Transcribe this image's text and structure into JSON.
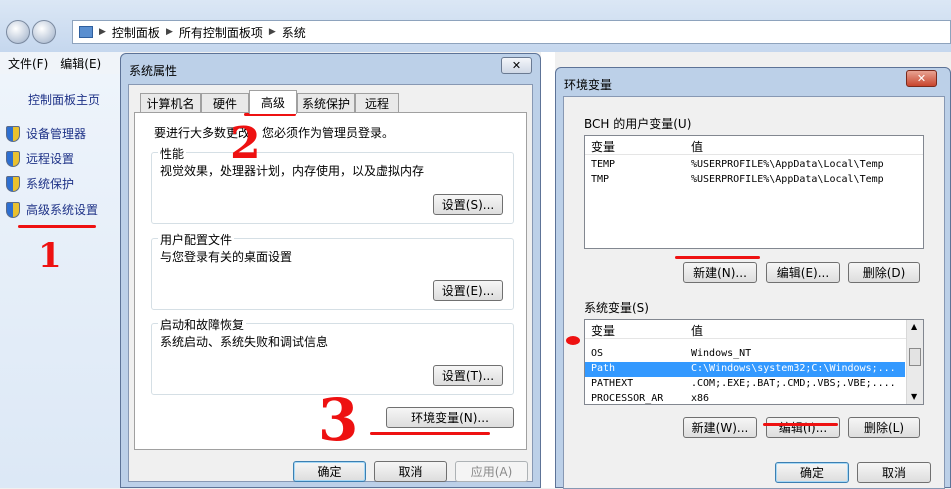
{
  "explorer": {
    "breadcrumb": [
      "控制面板",
      "所有控制面板项",
      "系统"
    ],
    "menu": [
      "文件(F)",
      "编辑(E)"
    ],
    "left_nav": {
      "home": "控制面板主页",
      "items": [
        "设备管理器",
        "远程设置",
        "系统保护",
        "高级系统设置"
      ]
    }
  },
  "system_properties": {
    "title": "系统属性",
    "tabs": [
      "计算机名",
      "硬件",
      "高级",
      "系统保护",
      "远程"
    ],
    "active_tab": "高级",
    "admin_note": "要进行大多数更改，您必须作为管理员登录。",
    "groups": [
      {
        "label": "性能",
        "text": "视觉效果，处理器计划，内存使用，以及虚拟内存",
        "button": "设置(S)..."
      },
      {
        "label": "用户配置文件",
        "text": "与您登录有关的桌面设置",
        "button": "设置(E)..."
      },
      {
        "label": "启动和故障恢复",
        "text": "系统启动、系统失败和调试信息",
        "button": "设置(T)..."
      }
    ],
    "env_button": "环境变量(N)...",
    "ok": "确定",
    "cancel": "取消",
    "apply": "应用(A)"
  },
  "environment_variables": {
    "title": "环境变量",
    "user_section": "BCH 的用户变量(U)",
    "columns": [
      "变量",
      "值"
    ],
    "user_vars": [
      {
        "name": "TEMP",
        "value": "%USERPROFILE%\\AppData\\Local\\Temp"
      },
      {
        "name": "TMP",
        "value": "%USERPROFILE%\\AppData\\Local\\Temp"
      }
    ],
    "user_buttons": [
      "新建(N)...",
      "编辑(E)...",
      "删除(D)"
    ],
    "system_section": "系统变量(S)",
    "system_vars": [
      {
        "name": "OS",
        "value": "Windows_NT"
      },
      {
        "name": "Path",
        "value": "C:\\Windows\\system32;C:\\Windows;..."
      },
      {
        "name": "PATHEXT",
        "value": ".COM;.EXE;.BAT;.CMD;.VBS;.VBE;...."
      },
      {
        "name": "PROCESSOR_AR",
        "value": "x86"
      }
    ],
    "selected_system_var": "Path",
    "system_buttons": [
      "新建(W)...",
      "编辑(I)...",
      "删除(L)"
    ],
    "ok": "确定",
    "cancel": "取消"
  },
  "annotations": [
    "1",
    "2",
    "3"
  ],
  "colors": {
    "annotation": "#ee1111",
    "selection": "#3399ff",
    "link": "#1e3287"
  }
}
